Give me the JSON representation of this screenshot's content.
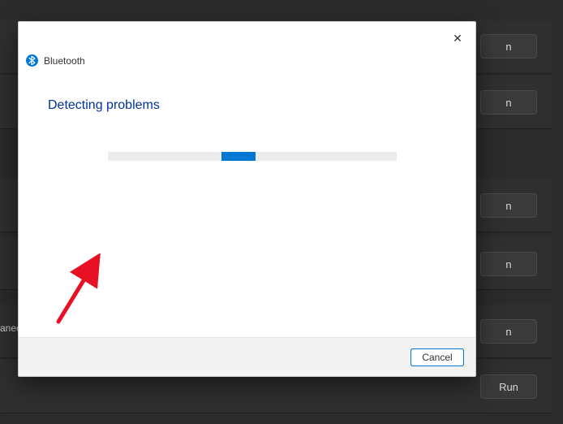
{
  "background": {
    "rows": [
      {
        "button_label": "n"
      },
      {
        "button_label": "n"
      },
      {
        "button_label": "n"
      },
      {
        "button_label": "n"
      },
      {
        "button_label": "n"
      },
      {
        "button_label": "Run"
      }
    ],
    "partial_label": "anec"
  },
  "dialog": {
    "title": "Bluetooth",
    "status_heading": "Detecting problems",
    "close_glyph": "✕",
    "footer": {
      "cancel_label": "Cancel"
    },
    "icon_name": "bluetooth-icon"
  },
  "colors": {
    "accent": "#0078d4",
    "heading": "#003399",
    "dark_bg": "#2b2b2b"
  }
}
